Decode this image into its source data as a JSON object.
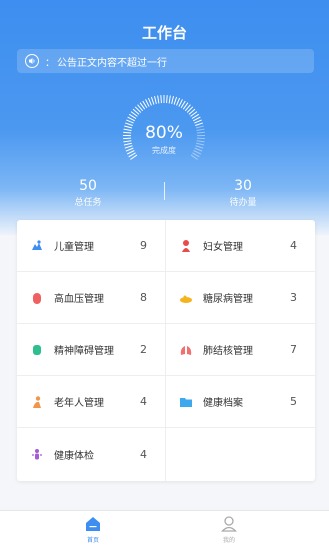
{
  "header": {
    "title": "工作台"
  },
  "notice": {
    "colon": "：",
    "text": "公告正文内容不超过一行"
  },
  "gauge": {
    "percent": "80%",
    "label": "完成度",
    "progress": 0.8
  },
  "stats": {
    "total": {
      "value": "50",
      "label": "总任务"
    },
    "pending": {
      "value": "30",
      "label": "待办量"
    }
  },
  "modules": [
    {
      "name": "儿童管理",
      "count": "9",
      "icon": "child-icon"
    },
    {
      "name": "妇女管理",
      "count": "4",
      "icon": "woman-icon"
    },
    {
      "name": "高血压管理",
      "count": "8",
      "icon": "blood-pressure-icon"
    },
    {
      "name": "糖尿病管理",
      "count": "3",
      "icon": "diabetes-icon"
    },
    {
      "name": "精神障碍管理",
      "count": "2",
      "icon": "mental-icon"
    },
    {
      "name": "肺结核管理",
      "count": "7",
      "icon": "lungs-icon"
    },
    {
      "name": "老年人管理",
      "count": "4",
      "icon": "elderly-icon"
    },
    {
      "name": "健康档案",
      "count": "5",
      "icon": "folder-icon"
    },
    {
      "name": "健康体检",
      "count": "4",
      "icon": "checkup-icon"
    }
  ],
  "tabbar": {
    "home": {
      "label": "首页",
      "icon": "home-icon"
    },
    "me": {
      "label": "我的",
      "icon": "user-icon"
    }
  },
  "colors": {
    "primary": "#3d8ef0",
    "tab_inactive": "#aaaaaa"
  }
}
